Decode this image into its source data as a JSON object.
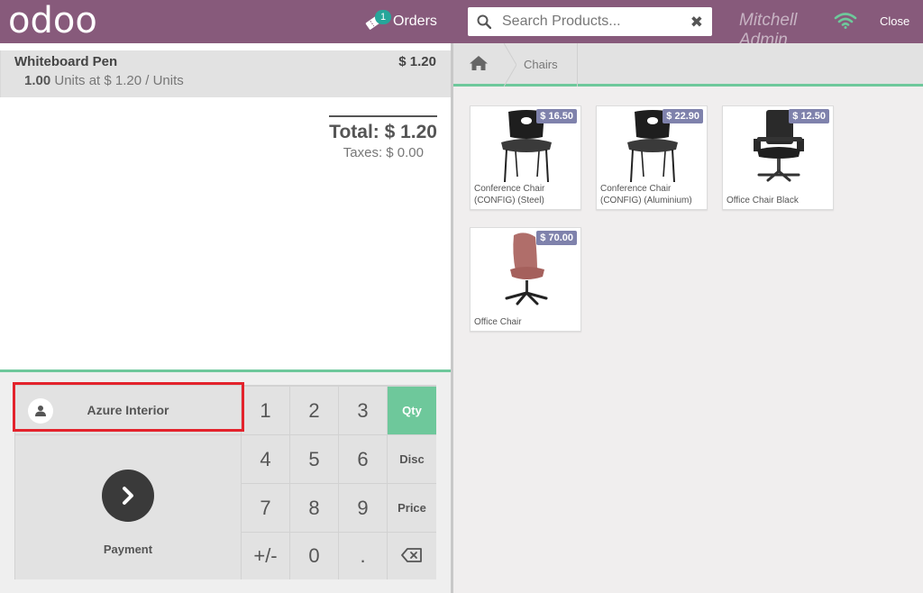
{
  "header": {
    "logo": "odoo",
    "orders_label": "Orders",
    "orders_count": "1",
    "search_placeholder": "Search Products...",
    "clear_icon": "✖",
    "user_name": "Mitchell Admin",
    "close_label": "Close"
  },
  "order": {
    "line": {
      "name": "Whiteboard Pen",
      "price": "$ 1.20",
      "qty": "1.00",
      "unit_info": "Units at $ 1.20 / Units"
    },
    "total_label": "Total: $ 1.20",
    "taxes_label": "Taxes: $ 0.00"
  },
  "controls": {
    "customer_name": "Azure Interior",
    "payment_label": "Payment",
    "numpad": [
      "1",
      "2",
      "3",
      "4",
      "5",
      "6",
      "7",
      "8",
      "9",
      "+/-",
      "0",
      "."
    ],
    "modes": [
      "Qty",
      "Disc",
      "Price"
    ],
    "active_mode": "Qty"
  },
  "categories": {
    "current": "Chairs"
  },
  "products": [
    {
      "name": "Conference Chair (CONFIG) (Steel)",
      "price": "$ 16.50",
      "icon": "black-chair-image"
    },
    {
      "name": "Conference Chair (CONFIG) (Aluminium)",
      "price": "$ 22.90",
      "icon": "black-chair-image"
    },
    {
      "name": "Office Chair Black",
      "price": "$ 12.50",
      "icon": "office-chair-black-image"
    },
    {
      "name": "Office Chair",
      "price": "$ 70.00",
      "icon": "pink-office-chair-image"
    }
  ],
  "colors": {
    "header": "#875a7b",
    "accent_green": "#6ec89b",
    "price_tag": "#7f82ac",
    "highlight": "#e3232c"
  }
}
